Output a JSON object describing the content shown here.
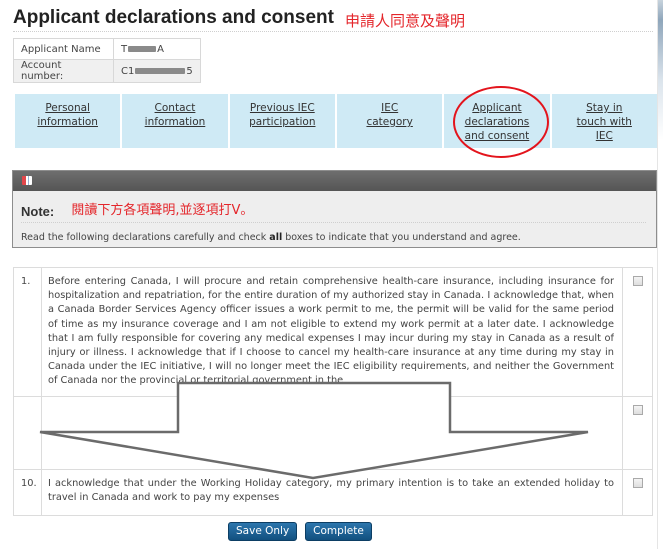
{
  "header": {
    "title": "Applicant declarations and consent",
    "annotation": "申請人同意及聲明"
  },
  "applicant_info": {
    "rows": [
      {
        "label": "Applicant Name",
        "value_prefix": "T",
        "value_suffix": "A",
        "redacted": true
      },
      {
        "label": "Account number:",
        "value_prefix": "C1",
        "value_suffix": "5",
        "redacted": true
      }
    ]
  },
  "steps": [
    {
      "label": "Personal information"
    },
    {
      "label": "Contact information"
    },
    {
      "label": "Previous IEC participation"
    },
    {
      "label": "IEC category"
    },
    {
      "label": "Applicant declarations and consent",
      "highlighted": true
    },
    {
      "label": "Stay in touch with IEC"
    }
  ],
  "note": {
    "icon": "book-icon",
    "label": "Note:",
    "annotation": "閱讀下方各項聲明,並逐項打V。",
    "text_before": "Read the following declarations carefully and check ",
    "text_bold": "all",
    "text_after": " boxes to indicate that you understand and agree."
  },
  "declarations": [
    {
      "number": "1.",
      "text": "Before entering Canada, I will procure and retain comprehensive health-care insurance, including insurance for hospitalization and repatriation, for the entire duration of my authorized stay in Canada. I acknowledge that, when a Canada Border Services Agency officer issues a work permit to me, the permit will be valid for the same period of time as my insurance coverage and I am not eligible to extend my work permit at a later date. I acknowledge that I am fully responsible for covering any medical expenses I may incur during my stay in Canada as a result of injury or illness. I acknowledge that if I choose to cancel my health-care insurance at any time during my stay in Canada under the IEC initiative, I will no longer meet the IEC eligibility requirements, and neither the Government of Canada nor the provincial or territorial government in the",
      "checked": false
    },
    {
      "number": "",
      "text": "",
      "checked": false
    },
    {
      "number": "10.",
      "text": "I acknowledge that under the Working Holiday category, my primary intention is to take an extended holiday to travel in Canada and work to pay my expenses",
      "checked": false
    }
  ],
  "annotation_arrow": {
    "direction": "down",
    "color": "#6b6b6b"
  },
  "annotation_ellipse": {
    "color": "#e3141c",
    "target": "Applicant declarations and consent"
  },
  "buttons": {
    "save_only": "Save Only",
    "complete": "Complete"
  }
}
